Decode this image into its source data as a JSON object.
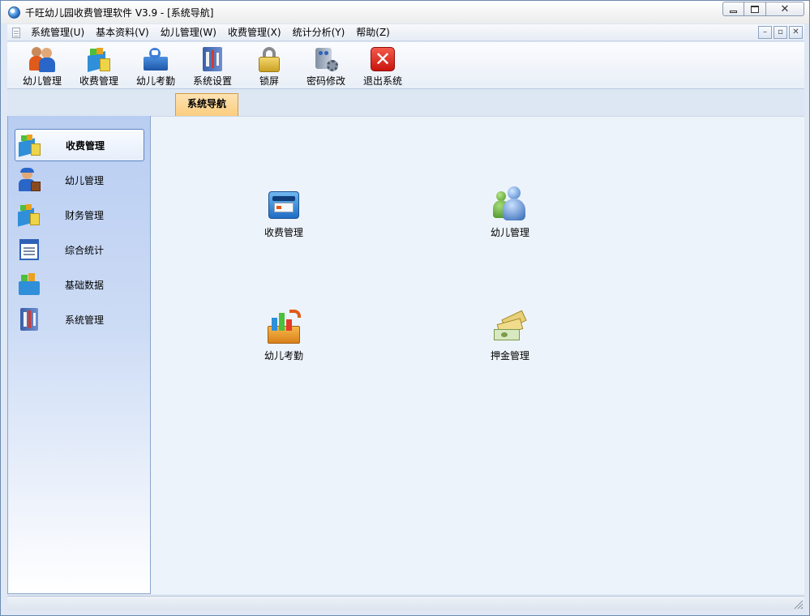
{
  "window": {
    "title": "千旺幼儿园收费管理软件 V3.9 - [系统导航]"
  },
  "menu": {
    "items": [
      "系统管理(U)",
      "基本资料(V)",
      "幼儿管理(W)",
      "收费管理(X)",
      "统计分析(Y)",
      "帮助(Z)"
    ]
  },
  "toolbar": {
    "buttons": [
      {
        "label": "幼儿管理",
        "icon": "people-icon"
      },
      {
        "label": "收费管理",
        "icon": "fee-icon"
      },
      {
        "label": "幼儿考勤",
        "icon": "attendance-icon"
      },
      {
        "label": "系统设置",
        "icon": "settings-icon"
      },
      {
        "label": "锁屏",
        "icon": "lock-icon"
      },
      {
        "label": "密码修改",
        "icon": "password-icon"
      },
      {
        "label": "退出系统",
        "icon": "exit-icon"
      }
    ]
  },
  "tabs": {
    "active": "系统导航"
  },
  "nav": {
    "items": [
      {
        "label": "收费管理",
        "icon": "fee-icon",
        "active": true
      },
      {
        "label": "幼儿管理",
        "icon": "child-icon",
        "active": false
      },
      {
        "label": "财务管理",
        "icon": "finance-icon",
        "active": false
      },
      {
        "label": "综合统计",
        "icon": "statistics-icon",
        "active": false
      },
      {
        "label": "基础数据",
        "icon": "basic-data-icon",
        "active": false
      },
      {
        "label": "系统管理",
        "icon": "system-icon",
        "active": false
      }
    ]
  },
  "main": {
    "items": [
      {
        "label": "收费管理",
        "icon": "cash-register-icon"
      },
      {
        "label": "幼儿管理",
        "icon": "users-icon"
      },
      {
        "label": "幼儿考勤",
        "icon": "chart-box-icon"
      },
      {
        "label": "押金管理",
        "icon": "money-icon"
      }
    ]
  },
  "colors": {
    "accent": "#5d86c2",
    "tab": "#fbcd7f",
    "exit": "#e02020"
  }
}
